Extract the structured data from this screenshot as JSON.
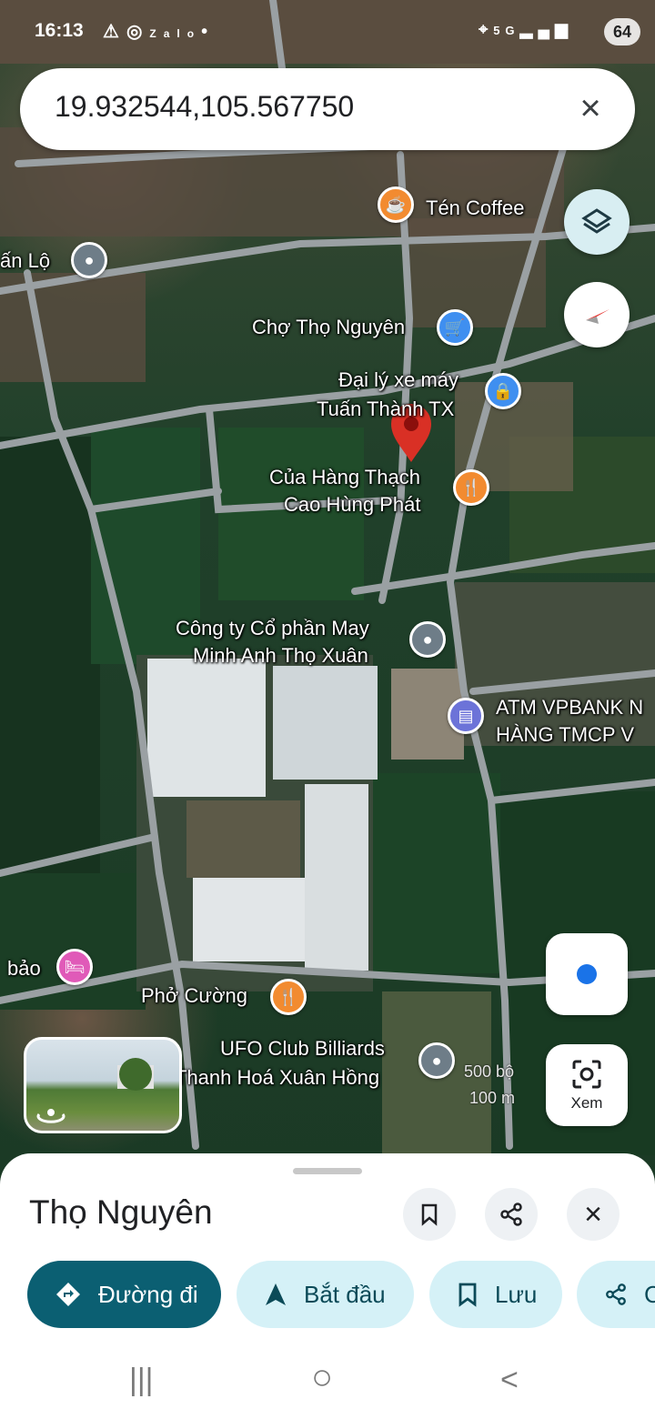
{
  "status_bar": {
    "time": "16:13",
    "left_icons": [
      "warning-icon",
      "instagram-icon",
      "zalo-icon",
      "dot-icon"
    ],
    "right_icons": [
      "location-icon",
      "5g-icon",
      "signal-icon"
    ],
    "battery": "64"
  },
  "search": {
    "query": "19.932544,105.567750",
    "clear_icon": "close-icon"
  },
  "map": {
    "pois": [
      {
        "label": "Tén Coffee",
        "icon": "coffee-icon",
        "color": "#f28b30"
      },
      {
        "label": "ấn Lộ",
        "icon": "place-icon",
        "color": "#6e7d88"
      },
      {
        "label": "Chợ Thọ Nguyên",
        "icon": "shopping-cart-icon",
        "color": "#3f8ff0"
      },
      {
        "label_line1": "Đại lý xe máy",
        "label_line2": "Tuấn Thành TX",
        "icon": "shopping-bag-icon",
        "color": "#3f8ff0"
      },
      {
        "label_line1": "Của Hàng Thạch",
        "label_line2": "Cao Hùng Phát",
        "icon": "restaurant-icon",
        "color": "#f28b30"
      },
      {
        "label_line1": "Công ty Cổ phần May",
        "label_line2": "Minh Anh Thọ Xuân",
        "icon": "place-icon",
        "color": "#6e7d88"
      },
      {
        "label_line1": "ATM VPBANK N",
        "label_line2": "HÀNG TMCP V",
        "icon": "bank-icon",
        "color": "#6c73d8"
      },
      {
        "label": "bảo",
        "icon": "hotel-icon",
        "color": "#e05ab8"
      },
      {
        "label": "Phở Cường",
        "icon": "restaurant-icon",
        "color": "#f28b30"
      },
      {
        "label_line1": "UFO Club Billiards",
        "label_line2": "Thanh Hoá Xuân Hồng",
        "icon": "place-icon",
        "color": "#6e7d88"
      }
    ],
    "dropped_pin_color": "#d93025",
    "scale_imperial": "500 bộ",
    "scale_metric": "100 m"
  },
  "controls": {
    "layers_icon": "layers-icon",
    "compass_icon": "compass-icon",
    "my_location_icon": "my-location-icon",
    "lens_label": "Xem",
    "lens_icon": "lens-icon",
    "street_view_icon": "street-view-rotate-icon"
  },
  "sheet": {
    "title": "Thọ Nguyên",
    "bookmark_icon": "bookmark-icon",
    "share_icon": "share-icon",
    "close_icon": "close-icon",
    "chips": [
      {
        "label": "Đường đi",
        "icon": "directions-icon"
      },
      {
        "label": "Bắt đầu",
        "icon": "navigation-arrow-icon"
      },
      {
        "label": "Lưu",
        "icon": "bookmark-icon"
      },
      {
        "label": "C",
        "icon": "share-icon"
      }
    ]
  },
  "nav": {
    "recent": "|||",
    "home": "○",
    "back": "<"
  },
  "colors": {
    "primary_chip": "#0b5f72",
    "secondary_chip": "#d5f1f7",
    "my_location": "#1a73e8"
  }
}
